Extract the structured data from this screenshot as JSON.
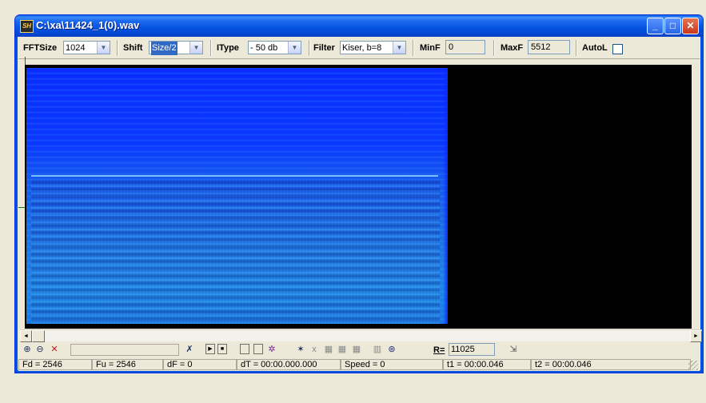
{
  "window": {
    "title": "C:\\xa\\11424_1(0).wav",
    "app_icon_text": "SH",
    "buttons": {
      "minimize": "_",
      "maximize": "□",
      "close": "✕"
    },
    "accent_color": "#0054e3"
  },
  "toolbar": {
    "fftsize_label": "FFTSize",
    "fftsize_value": "1024",
    "shift_label": "Shift",
    "shift_value": "Size/2",
    "itype_label": "IType",
    "itype_value": "- 50 db",
    "filter_label": "Filter",
    "filter_value": "Kiser, b=8",
    "minf_label": "MinF",
    "minf_value": "0",
    "maxf_label": "MaxF",
    "maxf_value": "5512",
    "autol_label": "AutoL",
    "autol_checked": false
  },
  "bottombar": {
    "rate_label": "R=",
    "rate_value": "11025",
    "icons": [
      "zoom-in-icon",
      "zoom-out-icon",
      "zoom-reset-icon",
      "clear-icon",
      "play-icon",
      "stop-icon",
      "box-1-icon",
      "box-2-icon",
      "settings-icon",
      "cursor-star-icon",
      "cursor-x-icon",
      "grid-1-icon",
      "grid-2-icon",
      "grid-3-icon",
      "grid-4-icon",
      "target-icon",
      "export-icon"
    ]
  },
  "status": {
    "fd": "Fd = 2546",
    "fu": "Fu = 2546",
    "df": "dF = 0",
    "dt": "dT = 00:00.000.000",
    "speed": "Speed = 0",
    "t1": "t1 = 00:00.046",
    "t2": "t2 = 00:00.046"
  },
  "spectrogram": {
    "colors": {
      "background": "#000000",
      "low": "#0a2cff",
      "high": "#1e84e8"
    }
  }
}
